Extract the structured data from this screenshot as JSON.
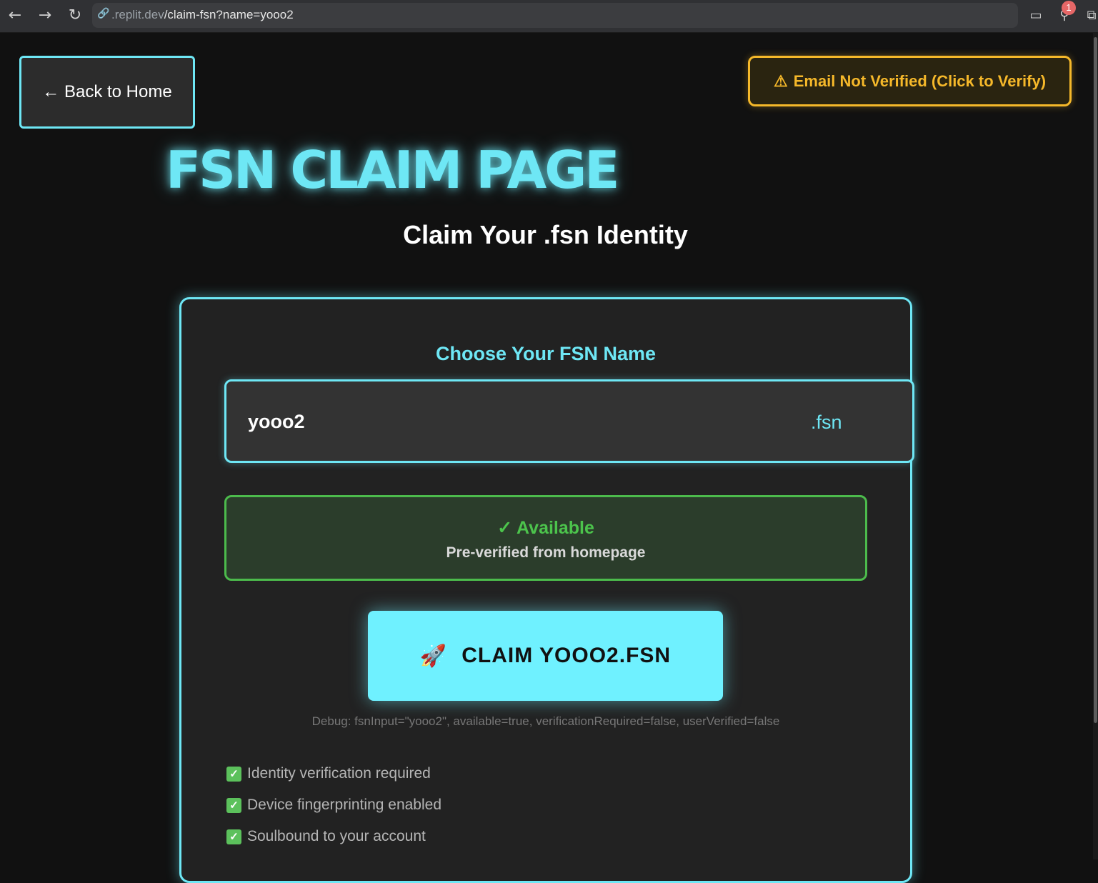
{
  "browser": {
    "url_host": ".replit.dev",
    "url_path": "/claim-fsn?name=yooo2",
    "notification_count": "1"
  },
  "header": {
    "back_label": "← Back to Home",
    "email_warning_label": "Email Not Verified (Click to Verify)"
  },
  "page": {
    "title": "FSN CLAIM PAGE",
    "subtitle": "Claim Your .fsn Identity"
  },
  "claim_card": {
    "choose_label": "Choose Your FSN Name",
    "input_value": "yooo2",
    "suffix": ".fsn",
    "status_title": "✓ Available",
    "status_subtitle": "Pre-verified from homepage",
    "claim_button_label": "CLAIM YOOO2.FSN",
    "debug_text": "Debug: fsnInput=\"yooo2\", available=true, verificationRequired=false, userVerified=false",
    "features": [
      "Identity verification required",
      "Device fingerprinting enabled",
      "Soulbound to your account"
    ]
  },
  "colors": {
    "accent": "#6ee7f5",
    "warning": "#f5b82a",
    "success": "#4cbb4c",
    "background": "#111111"
  }
}
